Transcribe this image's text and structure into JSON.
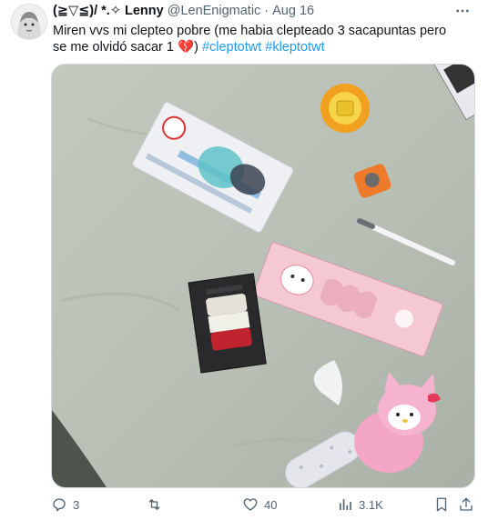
{
  "tweet": {
    "display_name": "(≧▽≦)/ *.✧ Lenny",
    "handle": "@LenEnigmatic",
    "separator": "·",
    "date": "Aug 16",
    "text_main": "Miren vvs mi clepteo pobre (me habia clepteado 3 sacapuntas pero se me olvidó sacar 1 ",
    "emoji": "💔",
    "text_after_emoji": ") ",
    "hashtags": [
      "#cleptotwt",
      "#kleptotwt"
    ]
  },
  "media": {
    "description_icon": "photo"
  },
  "actions": {
    "replies": "3",
    "retweets": "",
    "likes": "40",
    "views": "3.1K"
  },
  "colors": {
    "text": "#0f1419",
    "secondary": "#536471",
    "accent": "#1d9bf0",
    "border": "#cfd9de"
  }
}
